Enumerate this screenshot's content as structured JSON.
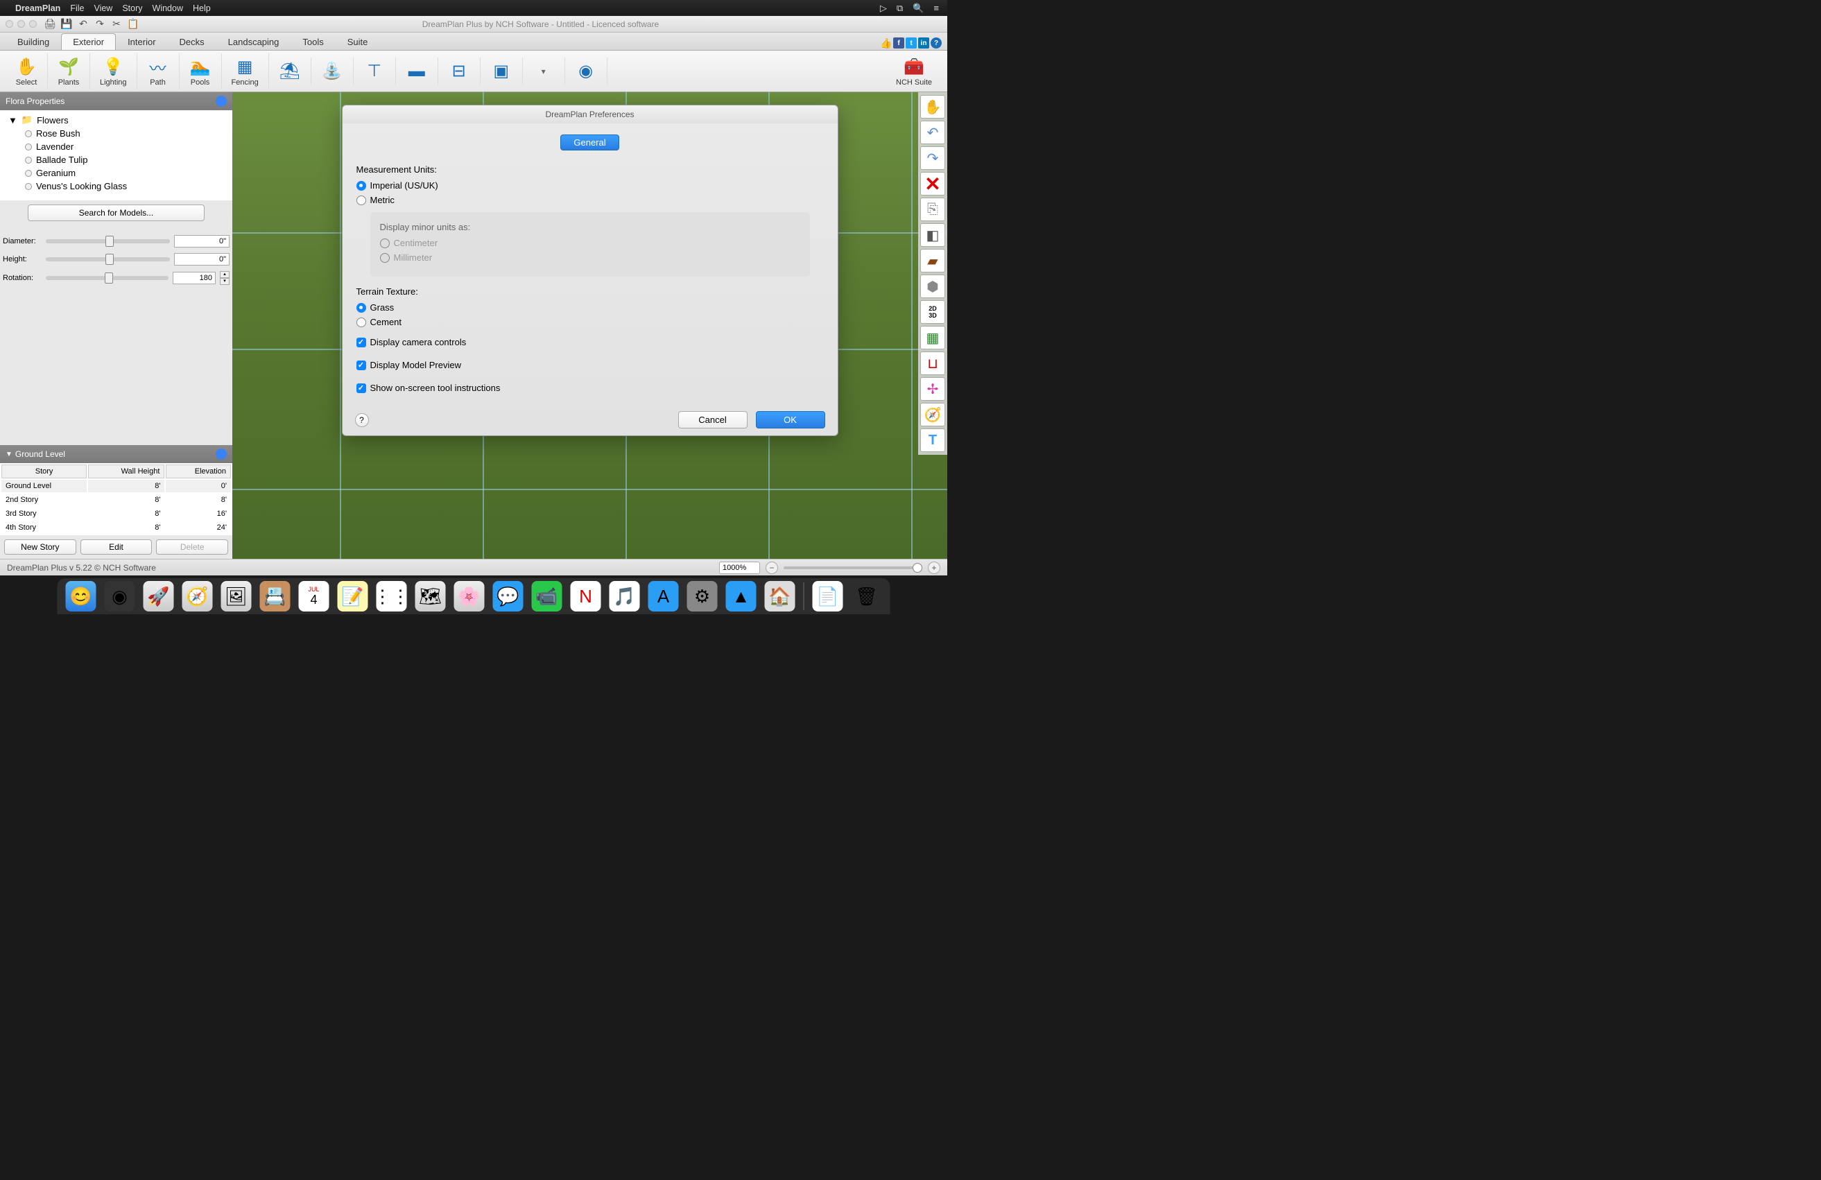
{
  "menubar": {
    "app": "DreamPlan",
    "items": [
      "File",
      "View",
      "Story",
      "Window",
      "Help"
    ]
  },
  "window_title": "DreamPlan Plus by NCH Software - Untitled - Licenced software",
  "tabs": [
    "Building",
    "Exterior",
    "Interior",
    "Decks",
    "Landscaping",
    "Tools",
    "Suite"
  ],
  "active_tab": "Exterior",
  "toolbar": [
    {
      "label": "Select",
      "icon": "✋"
    },
    {
      "label": "Plants",
      "icon": "🌱"
    },
    {
      "label": "Lighting",
      "icon": "💡"
    },
    {
      "label": "Path",
      "icon": "〰"
    },
    {
      "label": "Pools",
      "icon": "🏊"
    },
    {
      "label": "Fencing",
      "icon": "▦"
    },
    {
      "label": "",
      "icon": "⛱"
    },
    {
      "label": "",
      "icon": "⛲"
    },
    {
      "label": "",
      "icon": "⊤"
    },
    {
      "label": "",
      "icon": "▬"
    },
    {
      "label": "",
      "icon": "⊟"
    },
    {
      "label": "",
      "icon": "▣"
    },
    {
      "label": "",
      "icon": "◉"
    }
  ],
  "nch_suite": "NCH Suite",
  "flora": {
    "title": "Flora Properties",
    "folder": "Flowers",
    "items": [
      "Rose Bush",
      "Lavender",
      "Ballade Tulip",
      "Geranium",
      "Venus's Looking Glass"
    ],
    "search": "Search for Models...",
    "diameter": {
      "label": "Diameter:",
      "value": "0\""
    },
    "height": {
      "label": "Height:",
      "value": "0\""
    },
    "rotation": {
      "label": "Rotation:",
      "value": "180"
    }
  },
  "ground": {
    "title": "Ground Level",
    "headers": [
      "Story",
      "Wall Height",
      "Elevation"
    ],
    "rows": [
      {
        "story": "Ground Level",
        "wh": "8'",
        "el": "0'"
      },
      {
        "story": "2nd Story",
        "wh": "8'",
        "el": "8'"
      },
      {
        "story": "3rd Story",
        "wh": "8'",
        "el": "16'"
      },
      {
        "story": "4th Story",
        "wh": "8'",
        "el": "24'"
      }
    ],
    "buttons": {
      "new": "New Story",
      "edit": "Edit",
      "delete": "Delete"
    }
  },
  "prefs": {
    "title": "DreamPlan Preferences",
    "tab": "General",
    "measurement_label": "Measurement Units:",
    "imperial": "Imperial (US/UK)",
    "metric": "Metric",
    "minor_label": "Display minor units as:",
    "centimeter": "Centimeter",
    "millimeter": "Millimeter",
    "terrain_label": "Terrain Texture:",
    "grass": "Grass",
    "cement": "Cement",
    "camera": "Display camera controls",
    "preview": "Display Model Preview",
    "instructions": "Show on-screen tool instructions",
    "cancel": "Cancel",
    "ok": "OK"
  },
  "status": {
    "text": "DreamPlan Plus v 5.22 © NCH Software",
    "zoom": "1000%"
  }
}
